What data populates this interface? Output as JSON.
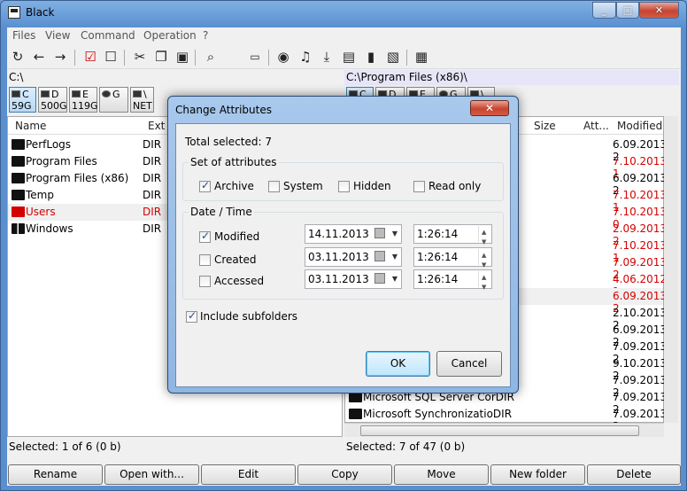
{
  "window": {
    "title": "Black",
    "min": "_",
    "max": "□",
    "close": "✕"
  },
  "menu": [
    "Files",
    "View",
    "Command",
    "Operation",
    "?"
  ],
  "toolbar": [
    "refresh-icon",
    "back-icon",
    "forward-icon",
    "check-all-icon",
    "uncheck-icon",
    "cut-icon",
    "copy-icon",
    "paste-icon",
    "find-icon",
    "terminal-icon",
    "media-icon",
    "music-icon",
    "download-icon",
    "archive-icon",
    "drive-icon",
    "image-icon",
    "grid-icon"
  ],
  "left": {
    "path": "C:\\",
    "drives": [
      {
        "letter": "C",
        "size": "59G"
      },
      {
        "letter": "D",
        "size": "500G"
      },
      {
        "letter": "E",
        "size": "119G"
      },
      {
        "letter": "G",
        "size": ""
      },
      {
        "letter": "\\",
        "size": "NET"
      }
    ],
    "columns": {
      "name": "Name",
      "ext": "Ext"
    },
    "rows": [
      {
        "name": "PerfLogs",
        "ext": "DIR"
      },
      {
        "name": "Program Files",
        "ext": "DIR"
      },
      {
        "name": "Program Files (x86)",
        "ext": "DIR"
      },
      {
        "name": "Temp",
        "ext": "DIR"
      },
      {
        "name": "Users",
        "ext": "DIR"
      },
      {
        "name": "Windows",
        "ext": "DIR"
      }
    ],
    "status": "Selected: 1 of 6 (0  b)"
  },
  "right": {
    "path": "C:\\Program Files (x86)\\",
    "columns": {
      "size": "Size",
      "attr": "Att...",
      "modified": "Modified"
    },
    "dates": [
      "6.09.2013 2",
      "7.10.2013 1",
      "6.09.2013 2",
      "7.10.2013 1",
      "7.10.2013 0",
      "2.09.2013 2",
      "7.10.2013 1",
      "7.09.2013 2",
      "4.06.2012 1",
      "6.09.2013 2",
      "2.10.2013 2",
      "6.09.2013 2",
      "7.09.2013 2",
      "9.10.2013 2",
      "7.09.2013 2",
      "7.09.2013 2",
      "7.09.2013 2"
    ],
    "bottom_rows": [
      "Microsoft SQL Server CorDIR",
      "Microsoft SynchronizatioDIR"
    ],
    "status": "Selected: 7 of 47 (0  b)"
  },
  "function_keys": [
    "Rename",
    "Open with...",
    "Edit",
    "Copy",
    "Move",
    "New folder",
    "Delete"
  ],
  "dialog": {
    "title": "Change Attributes",
    "close": "✕",
    "total": "Total selected: 7",
    "attr_group": "Set of attributes",
    "attrs": [
      {
        "label": "Archive",
        "checked": true
      },
      {
        "label": "System",
        "checked": false
      },
      {
        "label": "Hidden",
        "checked": false
      },
      {
        "label": "Read only",
        "checked": false
      }
    ],
    "dt_group": "Date / Time",
    "dates": [
      {
        "label": "Modified",
        "checked": true,
        "date": "14.11.2013",
        "time": "1:26:14"
      },
      {
        "label": "Created",
        "checked": false,
        "date": "03.11.2013",
        "time": "1:26:14"
      },
      {
        "label": "Accessed",
        "checked": false,
        "date": "03.11.2013",
        "time": "1:26:14"
      }
    ],
    "subfolders": {
      "label": "Include subfolders",
      "checked": true
    },
    "ok": "OK",
    "cancel": "Cancel"
  }
}
